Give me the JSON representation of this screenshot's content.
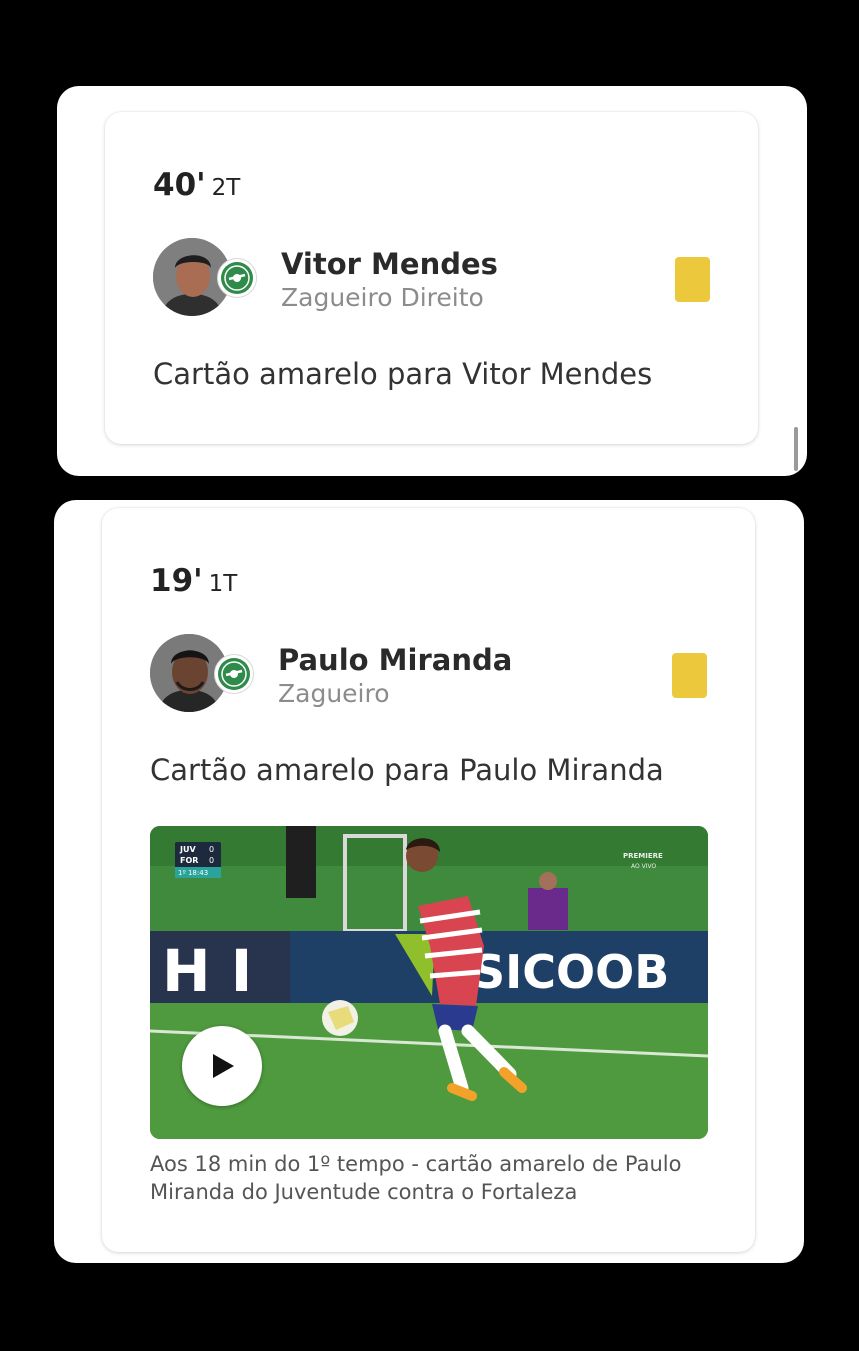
{
  "events": [
    {
      "time": "40'",
      "half": "2T",
      "player": {
        "name": "Vitor Mendes",
        "position": "Zagueiro Direito",
        "avatar_icon": "player-photo"
      },
      "team_badge_icon": "juventude-badge",
      "card_color": "#ecc93c",
      "description": "Cartão amarelo para Vitor Mendes"
    },
    {
      "time": "19'",
      "half": "1T",
      "player": {
        "name": "Paulo Miranda",
        "position": "Zagueiro",
        "avatar_icon": "player-photo"
      },
      "team_badge_icon": "juventude-badge",
      "card_color": "#ecc93c",
      "description": "Cartão amarelo para Paulo Miranda",
      "video": {
        "scoreboard": {
          "home": "JUV",
          "home_score": "0",
          "away": "FOR",
          "away_score": "0",
          "clock": "1º 18:43"
        },
        "broadcaster": "PREMIERE",
        "broadcast_status": "AO VIVO",
        "ad_board": "SICOOB",
        "ad_board_left": "H I",
        "play_icon": "play-icon",
        "caption": "Aos 18 min do 1º tempo - cartão amarelo de Paulo Miranda do Juventude contra o Fortaleza"
      }
    }
  ],
  "colors": {
    "accent_yellow": "#ecc93c",
    "badge_green": "#2e8b4a",
    "background": "#000000"
  }
}
